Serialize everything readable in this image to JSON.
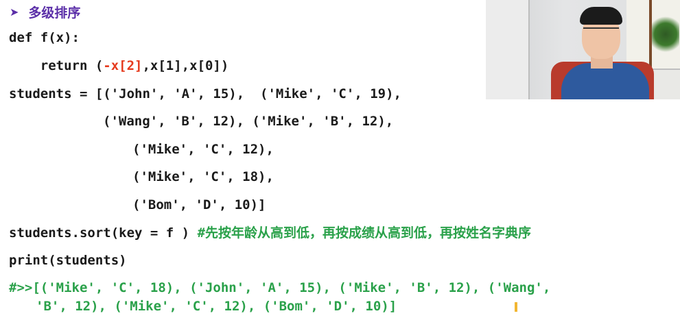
{
  "heading": {
    "bullet_icon": "right-triangle-bullet",
    "title": "多级排序"
  },
  "code": {
    "line1": "def f(x):",
    "line2_pre": "    return (",
    "line2_red": "-x[2]",
    "line2_post": ",x[1],x[0])",
    "line3": "students = [('John', 'A', 15),  ('Mike', 'C', 19),",
    "line4": "('Wang', 'B', 12), ('Mike', 'B', 12),",
    "line5": "('Mike', 'C', 12),",
    "line6": "('Mike', 'C', 18),",
    "line7": "('Bom', 'D', 10)]",
    "line8_code": "students.sort(key = f )",
    "line8_comment": "#先按年龄从高到低，再按成绩从高到低，再按姓名字典序",
    "line9": "print(students)",
    "output1": "#>>[('Mike', 'C', 18), ('John', 'A', 15), ('Mike', 'B', 12), ('Wang',",
    "output2": "'B', 12), ('Mike', 'C', 12), ('Bom', 'D', 10)]"
  },
  "colors": {
    "heading": "#5b2fa8",
    "code": "#1a1a1a",
    "highlight": "#e63a1e",
    "comment": "#2aa14a",
    "cursor": "#f2b632"
  }
}
